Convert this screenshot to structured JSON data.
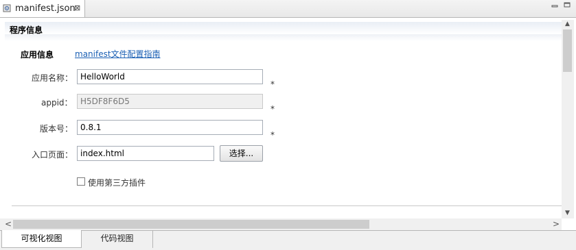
{
  "editor_tab": {
    "title": "manifest.json",
    "close": "⊠",
    "icon": "json-file-icon"
  },
  "window_controls": {
    "minimize": "minimize-icon",
    "maximize": "maximize-icon"
  },
  "section": {
    "title": "程序信息"
  },
  "app_info": {
    "heading": "应用信息",
    "guide_link": "manifest文件配置指南"
  },
  "fields": {
    "app_name": {
      "label": "应用名称：",
      "value": "HelloWorld",
      "required": "*"
    },
    "appid": {
      "label": "appid：",
      "value": "H5DF8F6D5",
      "required": "*"
    },
    "version": {
      "label": "版本号：",
      "value": "0.8.1",
      "required": "*"
    },
    "entry_page": {
      "label": "入口页面：",
      "value": "index.html",
      "button": "选择..."
    }
  },
  "third_party_plugin": {
    "label": "使用第三方插件",
    "checked": false
  },
  "scroll": {
    "up": "▲",
    "down": "▼",
    "left": "<",
    "right": ">"
  },
  "bottom_tabs": [
    {
      "label": "可视化视图",
      "active": true
    },
    {
      "label": "代码视图",
      "active": false
    }
  ]
}
